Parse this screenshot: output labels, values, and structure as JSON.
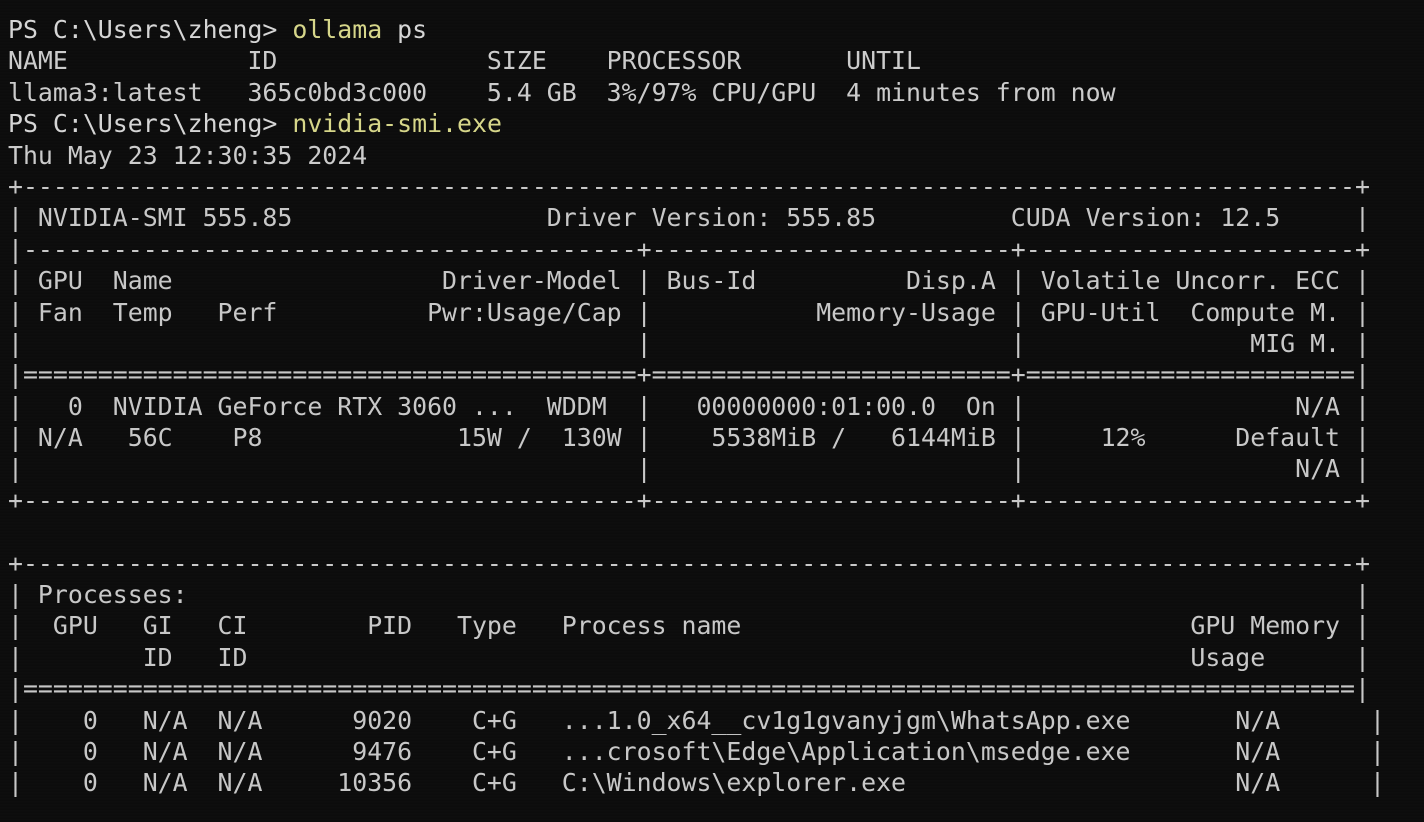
{
  "terminal": {
    "background_color": "#0c0c0c",
    "foreground_color": "#cccccc",
    "command_color": "#d7d78a",
    "prompt_text": "PS C:\\Users\\zheng>"
  },
  "ollama": {
    "command": "ollama",
    "command_args": " ps",
    "header": "NAME            ID              SIZE    PROCESSOR       UNTIL",
    "columns": [
      "NAME",
      "ID",
      "SIZE",
      "PROCESSOR",
      "UNTIL"
    ],
    "rows": [
      {
        "name": "llama3:latest",
        "id": "365c0bd3c000",
        "size": "5.4 GB",
        "processor": "3%/97% CPU/GPU",
        "until": "4 minutes from now",
        "raw": "llama3:latest   365c0bd3c000    5.4 GB  3%/97% CPU/GPU  4 minutes from now"
      }
    ]
  },
  "nvidia_smi": {
    "command": "nvidia-smi.exe",
    "timestamp": "Thu May 23 12:30:35 2024",
    "smi_version": "NVIDIA-SMI 555.85",
    "driver_version": "Driver Version: 555.85",
    "cuda_version": "CUDA Version: 12.5",
    "lines": [
      "+-----------------------------------------------------------------------------------------+",
      "| NVIDIA-SMI 555.85                 Driver Version: 555.85         CUDA Version: 12.5     |",
      "|-----------------------------------------+------------------------+----------------------+",
      "| GPU  Name                  Driver-Model | Bus-Id          Disp.A | Volatile Uncorr. ECC |",
      "| Fan  Temp   Perf          Pwr:Usage/Cap |           Memory-Usage | GPU-Util  Compute M. |",
      "|                                         |                        |               MIG M. |",
      "|=========================================+========================+======================|",
      "|   0  NVIDIA GeForce RTX 3060 ...  WDDM  |   00000000:01:00.0  On |                  N/A |",
      "| N/A   56C    P8             15W /  130W |    5538MiB /   6144MiB |     12%      Default |",
      "|                                         |                        |                  N/A |",
      "+-----------------------------------------+------------------------+----------------------+",
      "",
      "+-----------------------------------------------------------------------------------------+",
      "| Processes:                                                                              |",
      "|  GPU   GI   CI        PID   Type   Process name                              GPU Memory |",
      "|        ID   ID                                                               Usage      |",
      "|=========================================================================================|",
      "|    0   N/A  N/A      9020    C+G   ...1.0_x64__cv1g1gvanyjgm\\WhatsApp.exe       N/A      |",
      "|    0   N/A  N/A      9476    C+G   ...crosoft\\Edge\\Application\\msedge.exe       N/A      |",
      "|    0   N/A  N/A     10356    C+G   C:\\Windows\\explorer.exe                      N/A      |"
    ],
    "gpu_table": {
      "headers_row1": [
        "GPU",
        "Name",
        "Driver-Model",
        "Bus-Id",
        "Disp.A",
        "Volatile Uncorr. ECC"
      ],
      "headers_row2": [
        "Fan",
        "Temp",
        "Perf",
        "Pwr:Usage/Cap",
        "Memory-Usage",
        "GPU-Util",
        "Compute M."
      ],
      "headers_row3": [
        "MIG M."
      ],
      "gpu_index": "0",
      "gpu_name": "NVIDIA GeForce RTX 3060 ...",
      "driver_model": "WDDM",
      "bus_id": "00000000:01:00.0",
      "disp_a": "On",
      "ecc": "N/A",
      "fan": "N/A",
      "temp": "56C",
      "perf": "P8",
      "power": "15W /  130W",
      "memory_usage": "5538MiB /   6144MiB",
      "gpu_util": "12%",
      "compute_mode": "Default",
      "mig_mode": "N/A"
    },
    "processes": {
      "title": "Processes:",
      "headers": [
        "GPU",
        "GI",
        "CI",
        "PID",
        "Type",
        "Process name",
        "GPU Memory"
      ],
      "headers_second_line": [
        "ID",
        "ID",
        "Usage"
      ],
      "rows": [
        {
          "gpu": "0",
          "gi_id": "N/A",
          "ci_id": "N/A",
          "pid": "9020",
          "type": "C+G",
          "process_name": "...1.0_x64__cv1g1gvanyjgm\\WhatsApp.exe",
          "gpu_memory_usage": "N/A"
        },
        {
          "gpu": "0",
          "gi_id": "N/A",
          "ci_id": "N/A",
          "pid": "9476",
          "type": "C+G",
          "process_name": "...crosoft\\Edge\\Application\\msedge.exe",
          "gpu_memory_usage": "N/A"
        },
        {
          "gpu": "0",
          "gi_id": "N/A",
          "ci_id": "N/A",
          "pid": "10356",
          "type": "C+G",
          "process_name": "C:\\Windows\\explorer.exe",
          "gpu_memory_usage": "N/A"
        }
      ]
    }
  }
}
